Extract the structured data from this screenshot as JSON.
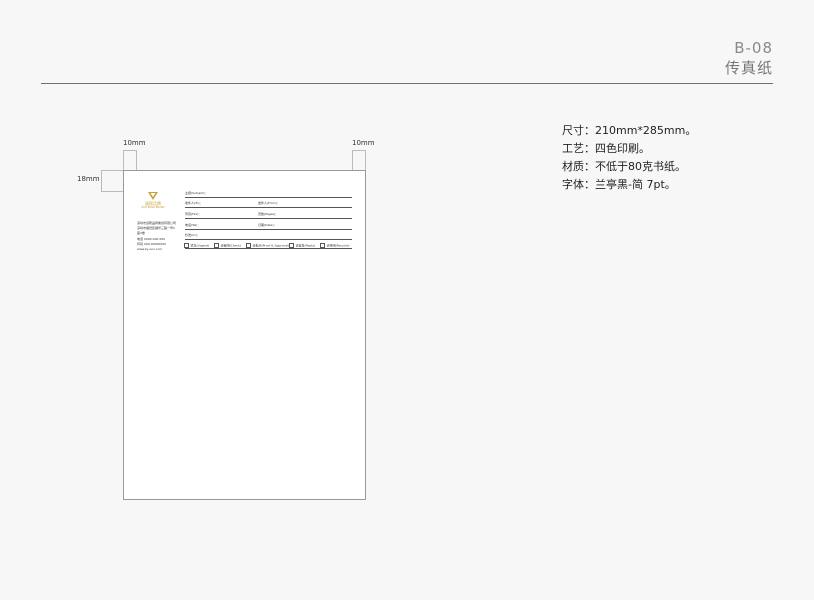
{
  "header": {
    "code": "B-08",
    "title": "传真纸"
  },
  "spec": {
    "size": "尺寸：210mm*285mm。",
    "process": "工艺：四色印刷。",
    "material": "材质：不低于80克书纸。",
    "font": "字体：兰亭黑-简 7pt。"
  },
  "dimensions": {
    "left_margin": "10mm",
    "right_margin": "10mm",
    "top_margin": "18mm"
  },
  "fax": {
    "brand_name": "道帮品牌",
    "brand_sub": "DAO BANG BRAND",
    "contact": [
      "深圳市道帮品牌策划有限公司",
      "深圳市福田区福华三路一号C",
      "座2楼",
      "电话 0000-000 000",
      "传真 000-00000000",
      "www.ky-sun.com"
    ],
    "fields": {
      "subject": "主题(Subject)：",
      "to": "收件人(To)：",
      "from": "发件人(From)：",
      "fax": "传真(Fax)：",
      "pages": "页数(Pages)：",
      "tel": "电话(Tel)：",
      "date": "日期(Date)：",
      "cc": "抄送(Cc)："
    },
    "options": [
      "紧急(Urgent)",
      "请审阅(Check)",
      "请批示(Proof & Approval)",
      "请答复(Reply)",
      "请传阅(Recycle)"
    ]
  },
  "colors": {
    "brand_gold": "#c9a13b",
    "rule": "#6f6f6f",
    "background": "#f7f7f7"
  }
}
